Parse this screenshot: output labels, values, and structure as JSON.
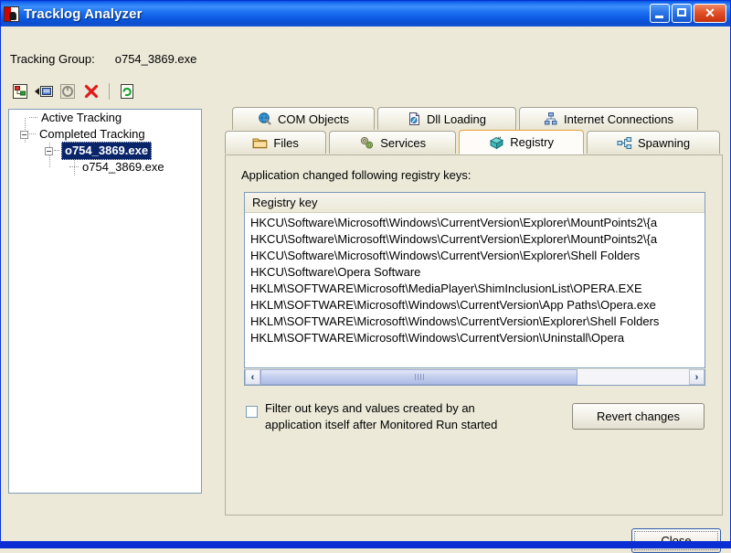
{
  "window": {
    "title": "Tracklog Analyzer",
    "icon": "app-icon",
    "buttons": {
      "minimize": "minimize-icon",
      "maximize": "maximize-icon",
      "close": "✕"
    }
  },
  "tracking_group": {
    "label": "Tracking Group:",
    "value": "o754_3869.exe"
  },
  "toolbar": {
    "items": [
      {
        "name": "new-tracking-icon"
      },
      {
        "name": "attach-tracking-icon"
      },
      {
        "name": "stop-tracking-icon"
      },
      {
        "name": "delete-tracking-icon"
      },
      {
        "name": "refresh-icon"
      }
    ]
  },
  "tree": {
    "nodes": [
      {
        "label": "Active Tracking",
        "level": 0,
        "expander": false,
        "selected": false
      },
      {
        "label": "Completed Tracking",
        "level": 0,
        "expander": true,
        "selected": false
      },
      {
        "label": "o754_3869.exe",
        "level": 1,
        "expander": true,
        "selected": true
      },
      {
        "label": "o754_3869.exe",
        "level": 2,
        "expander": false,
        "selected": false
      }
    ]
  },
  "tabs": {
    "row1": [
      {
        "label": "COM Objects",
        "icon": "globe-icon",
        "active": false
      },
      {
        "label": "Dll Loading",
        "icon": "document-icon",
        "active": false
      },
      {
        "label": "Internet Connections",
        "icon": "network-icon",
        "active": false
      }
    ],
    "row2": [
      {
        "label": "Files",
        "icon": "folder-icon",
        "active": false
      },
      {
        "label": "Services",
        "icon": "gears-icon",
        "active": false
      },
      {
        "label": "Registry",
        "icon": "registry-icon",
        "active": true
      },
      {
        "label": "Spawning",
        "icon": "spawning-icon",
        "active": false
      }
    ]
  },
  "panel": {
    "description": "Application changed following registry keys:",
    "list": {
      "column_header": "Registry key",
      "rows": [
        "HKCU\\Software\\Microsoft\\Windows\\CurrentVersion\\Explorer\\MountPoints2\\{a",
        "HKCU\\Software\\Microsoft\\Windows\\CurrentVersion\\Explorer\\MountPoints2\\{a",
        "HKCU\\Software\\Microsoft\\Windows\\CurrentVersion\\Explorer\\Shell Folders",
        "HKCU\\Software\\Opera Software",
        "HKLM\\SOFTWARE\\Microsoft\\MediaPlayer\\ShimInclusionList\\OPERA.EXE",
        "HKLM\\SOFTWARE\\Microsoft\\Windows\\CurrentVersion\\App Paths\\Opera.exe",
        "HKLM\\SOFTWARE\\Microsoft\\Windows\\CurrentVersion\\Explorer\\Shell Folders",
        "HKLM\\SOFTWARE\\Microsoft\\Windows\\CurrentVersion\\Uninstall\\Opera"
      ]
    },
    "scrollbar": {
      "left_arrow": "‹",
      "right_arrow": "›"
    },
    "filter_checkbox": {
      "line1": "Filter out keys and values created by an",
      "line2": "application itself after Monitored Run started",
      "checked": false
    },
    "revert_button": "Revert changes"
  },
  "footer": {
    "close_button": "Close"
  },
  "colors": {
    "titlebar_blue": "#0a5ae0",
    "window_bg": "#ece9d8",
    "active_tab_border": "#e5a33c",
    "selection_blue": "#0a246a",
    "field_border": "#7f9db9"
  }
}
